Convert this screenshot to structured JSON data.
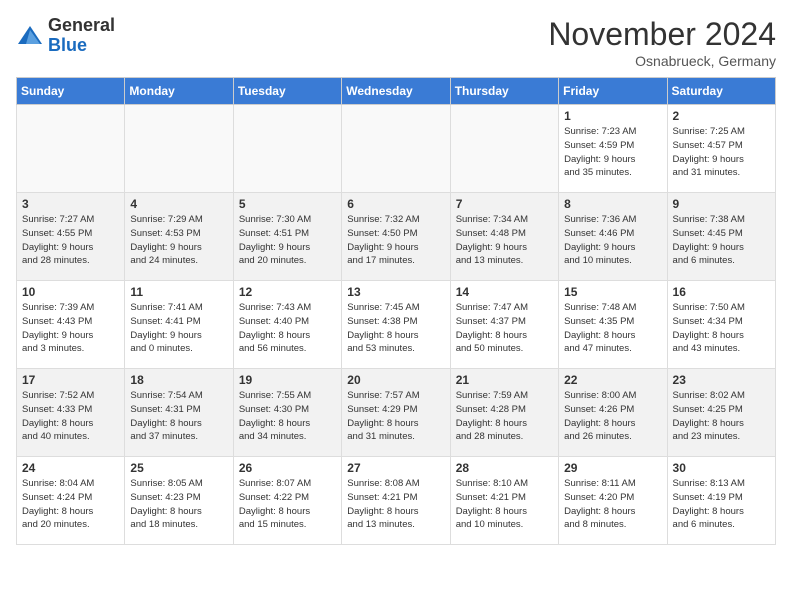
{
  "logo": {
    "general": "General",
    "blue": "Blue"
  },
  "header": {
    "month": "November 2024",
    "location": "Osnabrueck, Germany"
  },
  "days_of_week": [
    "Sunday",
    "Monday",
    "Tuesday",
    "Wednesday",
    "Thursday",
    "Friday",
    "Saturday"
  ],
  "weeks": [
    [
      {
        "day": "",
        "info": ""
      },
      {
        "day": "",
        "info": ""
      },
      {
        "day": "",
        "info": ""
      },
      {
        "day": "",
        "info": ""
      },
      {
        "day": "",
        "info": ""
      },
      {
        "day": "1",
        "info": "Sunrise: 7:23 AM\nSunset: 4:59 PM\nDaylight: 9 hours\nand 35 minutes."
      },
      {
        "day": "2",
        "info": "Sunrise: 7:25 AM\nSunset: 4:57 PM\nDaylight: 9 hours\nand 31 minutes."
      }
    ],
    [
      {
        "day": "3",
        "info": "Sunrise: 7:27 AM\nSunset: 4:55 PM\nDaylight: 9 hours\nand 28 minutes."
      },
      {
        "day": "4",
        "info": "Sunrise: 7:29 AM\nSunset: 4:53 PM\nDaylight: 9 hours\nand 24 minutes."
      },
      {
        "day": "5",
        "info": "Sunrise: 7:30 AM\nSunset: 4:51 PM\nDaylight: 9 hours\nand 20 minutes."
      },
      {
        "day": "6",
        "info": "Sunrise: 7:32 AM\nSunset: 4:50 PM\nDaylight: 9 hours\nand 17 minutes."
      },
      {
        "day": "7",
        "info": "Sunrise: 7:34 AM\nSunset: 4:48 PM\nDaylight: 9 hours\nand 13 minutes."
      },
      {
        "day": "8",
        "info": "Sunrise: 7:36 AM\nSunset: 4:46 PM\nDaylight: 9 hours\nand 10 minutes."
      },
      {
        "day": "9",
        "info": "Sunrise: 7:38 AM\nSunset: 4:45 PM\nDaylight: 9 hours\nand 6 minutes."
      }
    ],
    [
      {
        "day": "10",
        "info": "Sunrise: 7:39 AM\nSunset: 4:43 PM\nDaylight: 9 hours\nand 3 minutes."
      },
      {
        "day": "11",
        "info": "Sunrise: 7:41 AM\nSunset: 4:41 PM\nDaylight: 9 hours\nand 0 minutes."
      },
      {
        "day": "12",
        "info": "Sunrise: 7:43 AM\nSunset: 4:40 PM\nDaylight: 8 hours\nand 56 minutes."
      },
      {
        "day": "13",
        "info": "Sunrise: 7:45 AM\nSunset: 4:38 PM\nDaylight: 8 hours\nand 53 minutes."
      },
      {
        "day": "14",
        "info": "Sunrise: 7:47 AM\nSunset: 4:37 PM\nDaylight: 8 hours\nand 50 minutes."
      },
      {
        "day": "15",
        "info": "Sunrise: 7:48 AM\nSunset: 4:35 PM\nDaylight: 8 hours\nand 47 minutes."
      },
      {
        "day": "16",
        "info": "Sunrise: 7:50 AM\nSunset: 4:34 PM\nDaylight: 8 hours\nand 43 minutes."
      }
    ],
    [
      {
        "day": "17",
        "info": "Sunrise: 7:52 AM\nSunset: 4:33 PM\nDaylight: 8 hours\nand 40 minutes."
      },
      {
        "day": "18",
        "info": "Sunrise: 7:54 AM\nSunset: 4:31 PM\nDaylight: 8 hours\nand 37 minutes."
      },
      {
        "day": "19",
        "info": "Sunrise: 7:55 AM\nSunset: 4:30 PM\nDaylight: 8 hours\nand 34 minutes."
      },
      {
        "day": "20",
        "info": "Sunrise: 7:57 AM\nSunset: 4:29 PM\nDaylight: 8 hours\nand 31 minutes."
      },
      {
        "day": "21",
        "info": "Sunrise: 7:59 AM\nSunset: 4:28 PM\nDaylight: 8 hours\nand 28 minutes."
      },
      {
        "day": "22",
        "info": "Sunrise: 8:00 AM\nSunset: 4:26 PM\nDaylight: 8 hours\nand 26 minutes."
      },
      {
        "day": "23",
        "info": "Sunrise: 8:02 AM\nSunset: 4:25 PM\nDaylight: 8 hours\nand 23 minutes."
      }
    ],
    [
      {
        "day": "24",
        "info": "Sunrise: 8:04 AM\nSunset: 4:24 PM\nDaylight: 8 hours\nand 20 minutes."
      },
      {
        "day": "25",
        "info": "Sunrise: 8:05 AM\nSunset: 4:23 PM\nDaylight: 8 hours\nand 18 minutes."
      },
      {
        "day": "26",
        "info": "Sunrise: 8:07 AM\nSunset: 4:22 PM\nDaylight: 8 hours\nand 15 minutes."
      },
      {
        "day": "27",
        "info": "Sunrise: 8:08 AM\nSunset: 4:21 PM\nDaylight: 8 hours\nand 13 minutes."
      },
      {
        "day": "28",
        "info": "Sunrise: 8:10 AM\nSunset: 4:21 PM\nDaylight: 8 hours\nand 10 minutes."
      },
      {
        "day": "29",
        "info": "Sunrise: 8:11 AM\nSunset: 4:20 PM\nDaylight: 8 hours\nand 8 minutes."
      },
      {
        "day": "30",
        "info": "Sunrise: 8:13 AM\nSunset: 4:19 PM\nDaylight: 8 hours\nand 6 minutes."
      }
    ]
  ]
}
